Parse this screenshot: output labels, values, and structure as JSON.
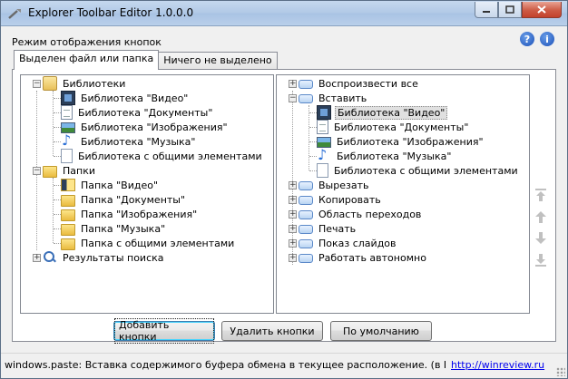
{
  "window": {
    "title": "Explorer Toolbar Editor 1.0.0.0"
  },
  "mode_label": "Режим отображения кнопок",
  "tabs": [
    {
      "label": "Выделен файл или папка",
      "active": true
    },
    {
      "label": "Ничего не выделено",
      "active": false
    }
  ],
  "left_tree": {
    "libraries": {
      "label": "Библиотеки",
      "children": [
        "Библиотека \"Видео\"",
        "Библиотека \"Документы\"",
        "Библиотека \"Изображения\"",
        "Библиотека \"Музыка\"",
        "Библиотека с общими элементами"
      ]
    },
    "folders": {
      "label": "Папки",
      "children": [
        "Папка \"Видео\"",
        "Папка \"Документы\"",
        "Папка \"Изображения\"",
        "Папка \"Музыка\"",
        "Папка с общими элементами"
      ]
    },
    "search_results": {
      "label": "Результаты поиска"
    }
  },
  "right_tree": {
    "items": [
      {
        "label": "Воспроизвести все",
        "expanded": false
      },
      {
        "label": "Вставить",
        "expanded": true,
        "children": [
          "Библиотека \"Видео\"",
          "Библиотека \"Документы\"",
          "Библиотека \"Изображения\"",
          "Библиотека \"Музыка\"",
          "Библиотека с общими элементами"
        ],
        "selected_child": 0
      },
      {
        "label": "Вырезать",
        "expanded": false
      },
      {
        "label": "Копировать",
        "expanded": false
      },
      {
        "label": "Область переходов",
        "expanded": false
      },
      {
        "label": "Печать",
        "expanded": false
      },
      {
        "label": "Показ слайдов",
        "expanded": false
      },
      {
        "label": "Работать автономно",
        "expanded": false
      }
    ]
  },
  "buttons": {
    "add": "Добавить кнопки",
    "remove": "Удалить кнопки",
    "default": "По умолчанию"
  },
  "status": {
    "text": "windows.paste: Вставка содержимого буфера обмена в текущее расположение. (в Библ",
    "link": "http://winreview.ru"
  }
}
